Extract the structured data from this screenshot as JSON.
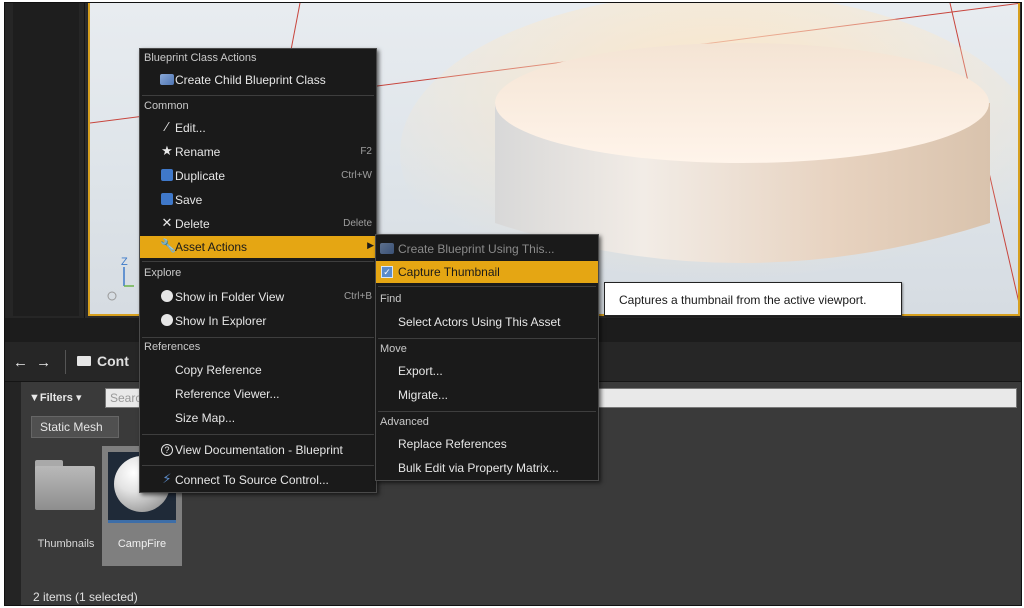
{
  "content_browser": {
    "nav_arrows": "← →",
    "path_label": "Cont",
    "filters_label": "▼Filters ▾",
    "search_placeholder": "Searc",
    "filter_chip": "Static Mesh",
    "assets": [
      {
        "name": "Thumbnails",
        "kind": "folder"
      },
      {
        "name": "CampFire",
        "kind": "static-mesh",
        "selected": true
      }
    ],
    "status": "2 items (1 selected)"
  },
  "context_menu": {
    "sections": {
      "blueprint": "Blueprint Class Actions",
      "common": "Common",
      "explore": "Explore",
      "references": "References"
    },
    "items": {
      "create_child": "Create Child Blueprint Class",
      "edit": "Edit...",
      "rename": "Rename",
      "rename_sc": "F2",
      "duplicate": "Duplicate",
      "duplicate_sc": "Ctrl+W",
      "save": "Save",
      "delete": "Delete",
      "delete_sc": "Delete",
      "asset_actions": "Asset Actions",
      "show_folder": "Show in Folder View",
      "show_folder_sc": "Ctrl+B",
      "show_explorer": "Show In Explorer",
      "copy_ref": "Copy Reference",
      "ref_viewer": "Reference Viewer...",
      "size_map": "Size Map...",
      "view_docs": "View Documentation - Blueprint",
      "source_control": "Connect To Source Control..."
    }
  },
  "submenu": {
    "sections": {
      "find": "Find",
      "move": "Move",
      "advanced": "Advanced"
    },
    "items": {
      "create_bp": "Create Blueprint Using This...",
      "capture": "Capture Thumbnail",
      "select_actors": "Select Actors Using This Asset",
      "export": "Export...",
      "migrate": "Migrate...",
      "replace_refs": "Replace References",
      "bulk_edit": "Bulk Edit via Property Matrix..."
    }
  },
  "tooltip": "Captures a thumbnail from the active viewport.",
  "colors": {
    "highlight": "#e5a613",
    "menu_bg": "#1a1a1a",
    "viewport_border": "#d7a01f"
  }
}
